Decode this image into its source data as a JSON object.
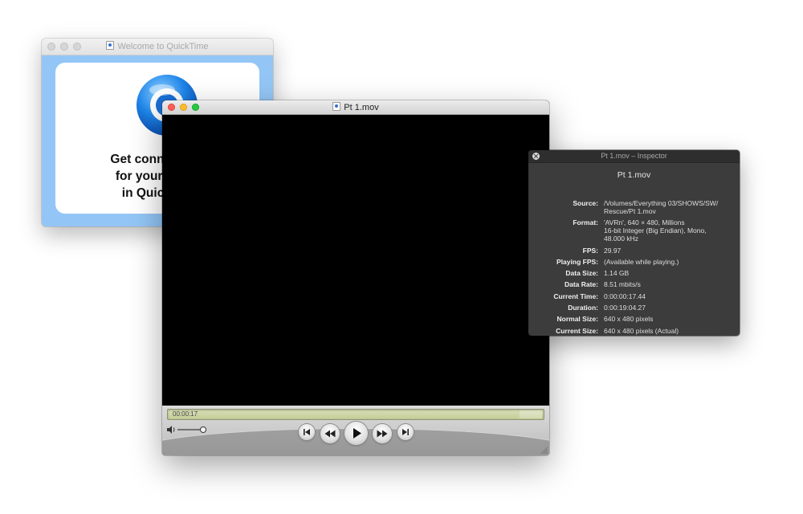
{
  "welcome_window": {
    "title": "Welcome to QuickTime",
    "text": "Get connected t\nfor your guide\nin QuickTim"
  },
  "player_window": {
    "title": "Pt 1.mov",
    "timecode": "00:00:17"
  },
  "inspector": {
    "title": "Pt 1.mov – Inspector",
    "filename": "Pt 1.mov",
    "rows": [
      {
        "label": "Source:",
        "value": "/Volumes/Everything 03/SHOWS/SW/\nRescue/Pt 1.mov"
      },
      {
        "label": "Format:",
        "value": "'AVRn', 640 × 480, Millions\n16-bit Integer (Big Endian), Mono,\n48.000 kHz"
      },
      {
        "label": "FPS:",
        "value": "29.97"
      },
      {
        "label": "Playing FPS:",
        "value": "(Available while playing.)"
      },
      {
        "label": "Data Size:",
        "value": "1.14 GB"
      },
      {
        "label": "Data Rate:",
        "value": "8.51 mbits/s"
      },
      {
        "label": "Current Time:",
        "value": "0:00:00:17.44"
      },
      {
        "label": "Duration:",
        "value": "0:00:19:04.27"
      },
      {
        "label": "Normal Size:",
        "value": "640 x 480 pixels"
      },
      {
        "label": "Current Size:",
        "value": "640 x 480 pixels (Actual)"
      }
    ]
  },
  "colors": {
    "close": "#fe5f57",
    "minimize": "#febc2e",
    "zoom": "#28c840",
    "timeline": "#c8d09e",
    "quicktime_blue": "#1e7fe0"
  },
  "icons": {
    "logo": "quicktime-logo",
    "volume": "speaker-icon",
    "skip_back": "skip-to-start-icon",
    "rewind": "rewind-icon",
    "play": "play-icon",
    "fast_forward": "fast-forward-icon",
    "skip_forward": "skip-to-end-icon",
    "inspector_close": "close-icon"
  }
}
